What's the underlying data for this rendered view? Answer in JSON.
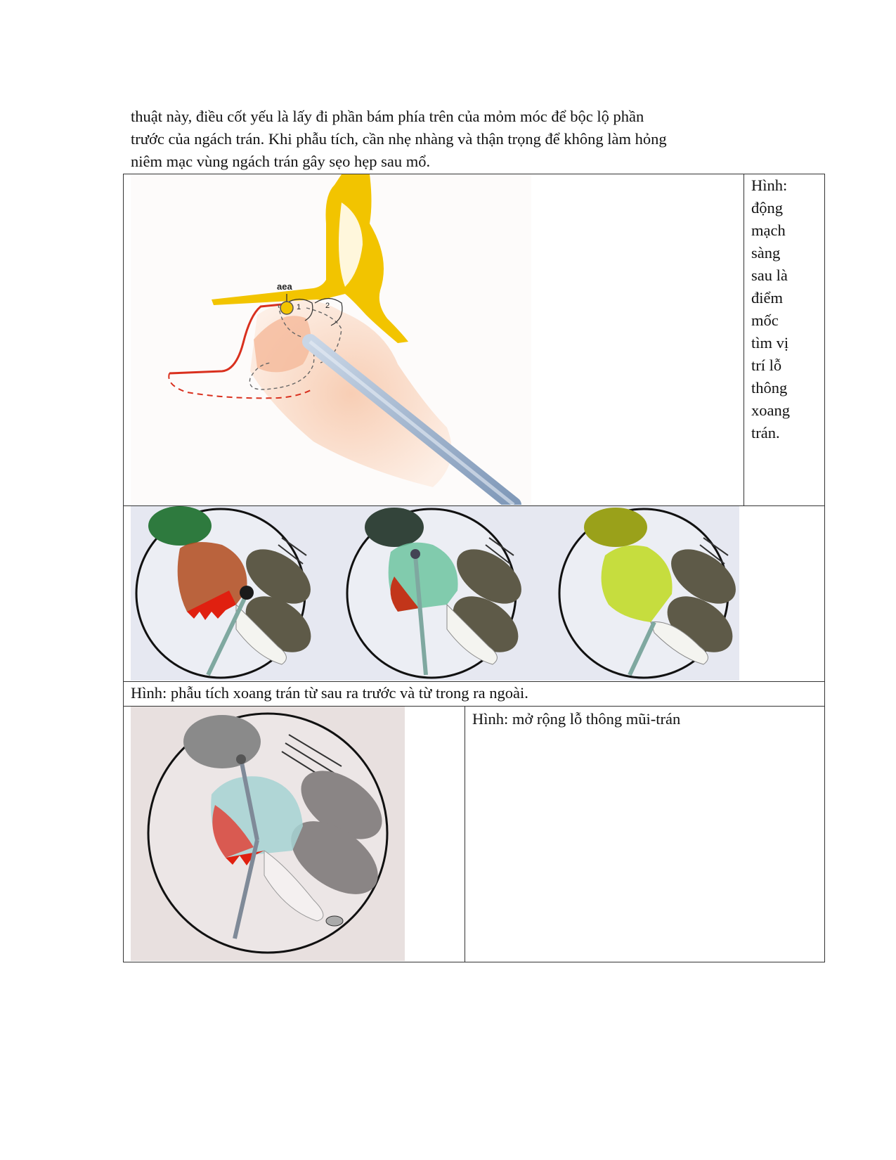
{
  "intro_lines": [
    "thuật này, điều cốt yếu là lấy đi phần bám phía trên của mỏm móc để bộc lộ phần",
    "trước của ngách trán. Khi phẫu tích, cần nhẹ nhàng và thận trọng để không làm hỏng",
    "niêm mạc vùng ngách trán gây sẹo hẹp sau mổ."
  ],
  "figure1": {
    "labels": {
      "artery": "aea",
      "cell1": "1",
      "cell2": "2"
    },
    "caption_words": [
      "Hình:",
      "động",
      "mạch",
      "sàng",
      "sau là",
      "điểm",
      "mốc",
      "tìm vị",
      "trí lỗ",
      "thông",
      "xoang",
      "trán."
    ]
  },
  "figure2": {
    "caption": "Hình: phẫu tích xoang trán từ sau ra trước và từ trong ra ngoài."
  },
  "figure3": {
    "caption": "Hình: mở rộng lỗ thông mũi-trán"
  },
  "colors": {
    "bone": "#f2c400",
    "mucosa": "#f9d9c6",
    "artery_line": "#d9301e",
    "instrument": "#9fb4cc",
    "panel_bg": "#e6e8f1"
  }
}
